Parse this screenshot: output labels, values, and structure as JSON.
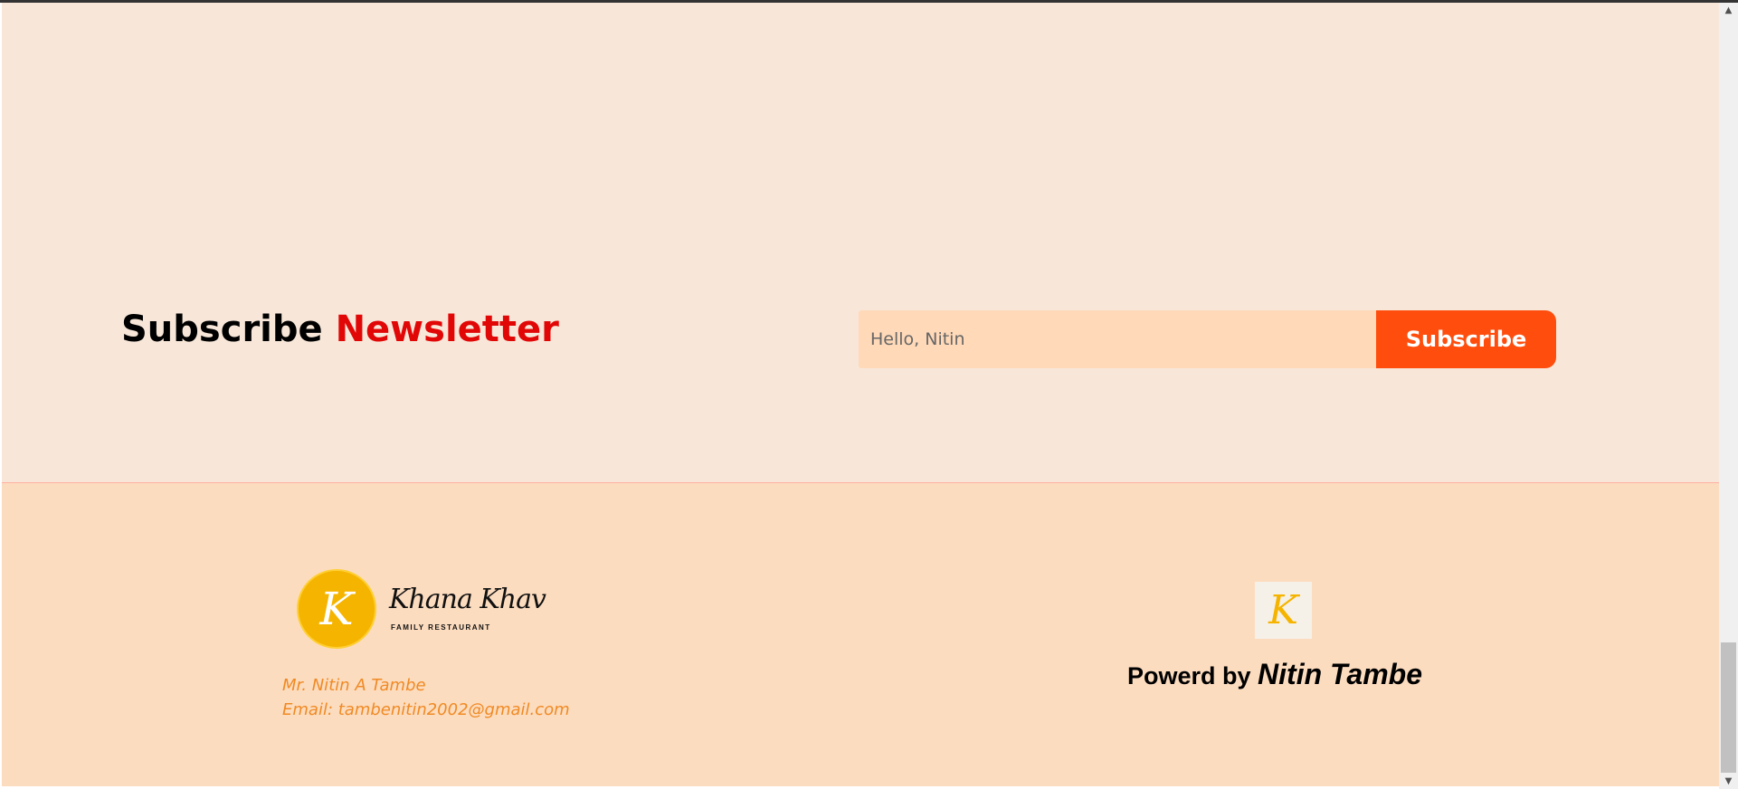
{
  "newsletter": {
    "title_part1": "Subscribe",
    "title_part2": "Newsletter",
    "input_placeholder": "Hello, Nitin",
    "button_label": "Subscribe"
  },
  "footer": {
    "brand": {
      "logo_letter": "K",
      "name": "Khana Khav",
      "tagline": "FAMILY RESTAURANT"
    },
    "contact": {
      "name": "Mr. Nitin A Tambe",
      "email": "Email: tambenitin2002@gmail.com"
    },
    "powered": {
      "logo_letter": "K",
      "prefix": "Powerd by",
      "name": "Nitin Tambe"
    }
  },
  "scrollbar": {
    "up_arrow": "▲",
    "down_arrow": "▼"
  },
  "colors": {
    "newsletter_bg": "#f8e7d9",
    "footer_bg": "#fcdcbf",
    "accent_red": "#e10707",
    "button_orange": "#ff4d0d",
    "contact_orange": "#f08a24",
    "brand_yellow": "#f5b400"
  }
}
